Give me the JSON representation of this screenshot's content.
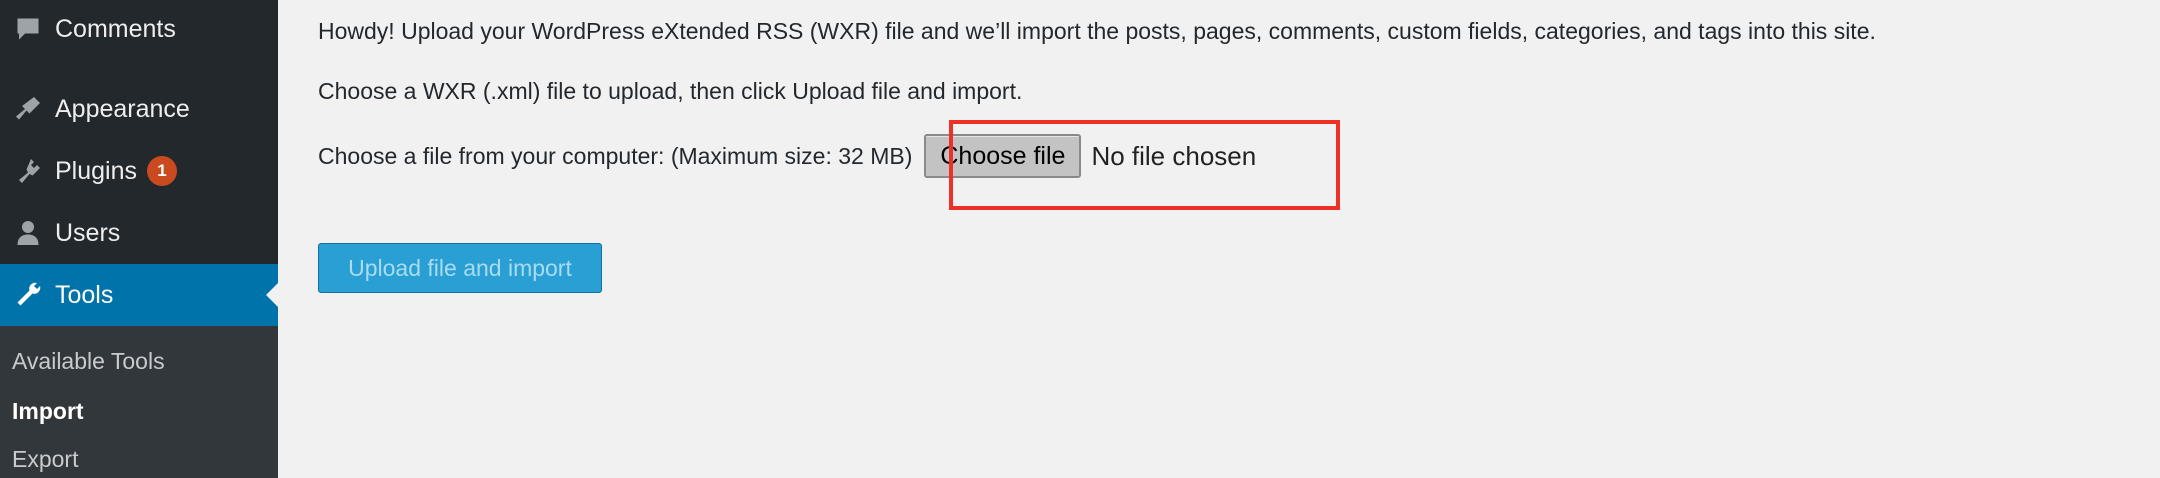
{
  "sidebar": {
    "items": [
      {
        "label": "Comments",
        "icon": "comments-icon"
      },
      {
        "label": "Appearance",
        "icon": "appearance-brush-icon"
      },
      {
        "label": "Plugins",
        "icon": "plugins-icon",
        "badge": "1"
      },
      {
        "label": "Users",
        "icon": "users-icon"
      },
      {
        "label": "Tools",
        "icon": "wrench-icon",
        "active": true
      }
    ],
    "submenu": [
      {
        "label": "Available Tools"
      },
      {
        "label": "Import",
        "current": true
      },
      {
        "label": "Export"
      }
    ]
  },
  "main": {
    "intro": "Howdy! Upload your WordPress eXtended RSS (WXR) file and we’ll import the posts, pages, comments, custom fields, categories, and tags into this site.",
    "instruction": "Choose a WXR (.xml) file to upload, then click Upload file and import.",
    "file_label": "Choose a file from your computer: (Maximum size: 32 MB)",
    "choose_file_button": "Choose file",
    "no_file_text": "No file chosen",
    "upload_button": "Upload file and import"
  },
  "colors": {
    "sidebar_bg": "#23282d",
    "submenu_bg": "#32373c",
    "active_bg": "#0073aa",
    "badge_bg": "#ca4a1f",
    "highlight": "#ee3124",
    "upload_button_bg": "#2a9fd3"
  }
}
